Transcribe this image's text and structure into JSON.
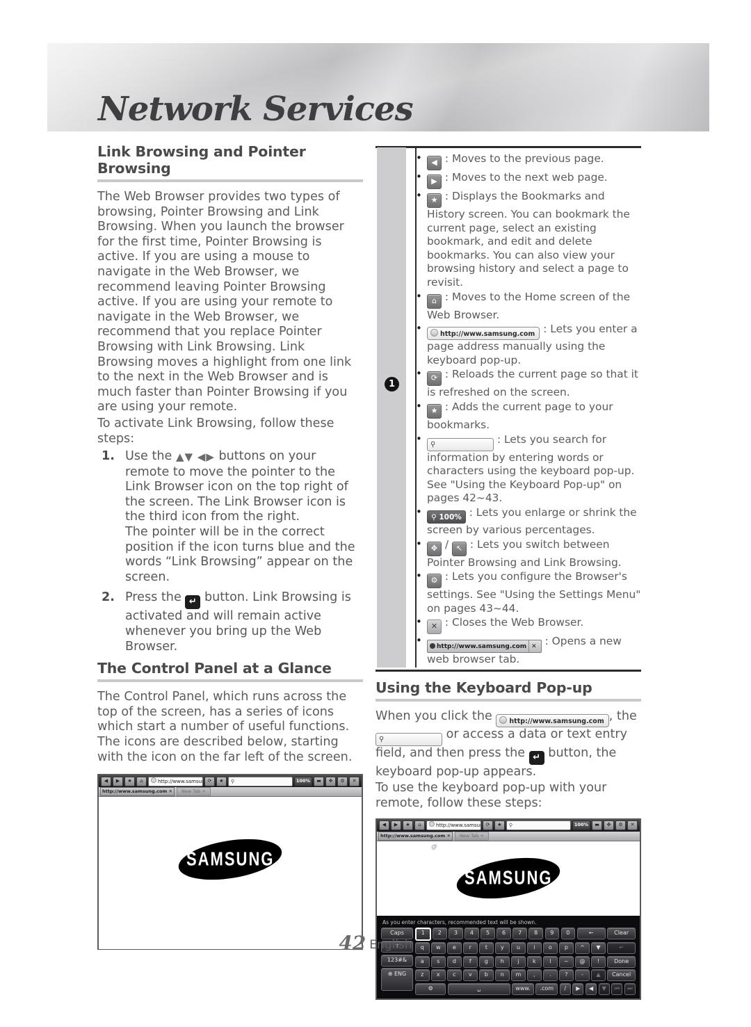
{
  "header": {
    "title": "Network Services"
  },
  "left": {
    "section1_title": "Link Browsing and Pointer Browsing",
    "para1": "The Web Browser provides two types of browsing, Pointer Browsing and Link Browsing. When you launch the browser for the first time, Pointer Browsing is active. If you are using a mouse to navigate in the Web Browser, we recommend leaving Pointer Browsing active. If you are using your remote to navigate in the Web Browser, we recommend that you replace Pointer Browsing with Link Browsing. Link Browsing moves a highlight from one link to the next in the Web Browser and is much faster than Pointer Browsing if you are using your remote.",
    "para2": "To activate Link Browsing, follow these steps:",
    "step1_num": "1.",
    "step1_a": "Use the",
    "step1_arrows": "▲▼ ◀▶",
    "step1_b": "buttons on your remote to move the pointer to the Link Browser icon on the top right of the screen. The Link Browser icon is the third icon from the right.",
    "step1_c": "The pointer will be in the correct position if the icon turns blue and the words “Link Browsing” appear on the screen.",
    "step2_num": "2.",
    "step2_a": "Press the",
    "step2_b": "button. Link Browsing is activated and will remain active whenever you bring up the Web Browser.",
    "section2_title": "The Control Panel at a Glance",
    "para3": "The Control Panel, which runs across the top of the screen, has a series of icons which start a number of useful functions. The icons are described below, starting with the icon on the far left of the screen."
  },
  "right": {
    "marker": "1",
    "bullets": [
      {
        "icon": "back-arrow-icon",
        "glyph": "◀",
        "text": ": Moves to the previous page."
      },
      {
        "icon": "forward-arrow-icon",
        "glyph": "▶",
        "text": ": Moves to the next web page."
      },
      {
        "icon": "bookmarks-history-icon",
        "glyph": "★",
        "text": ": Displays the Bookmarks and History screen. You can bookmark the current page, select an existing bookmark, and edit and delete bookmarks. You can also view your browsing history and select a page to revisit."
      },
      {
        "icon": "home-icon",
        "glyph": "⌂",
        "text": ": Moves to the Home screen of the Web Browser."
      },
      {
        "icon": "url-bar-icon",
        "glyph": "",
        "url": "http://www.samsung.com",
        "text": ": Lets you enter a page address manually using the keyboard pop-up."
      },
      {
        "icon": "reload-icon",
        "glyph": "⟳",
        "text": ": Reloads the current page so that it is refreshed on the screen."
      },
      {
        "icon": "add-bookmark-icon",
        "glyph": "★",
        "text": ": Adds the current page to your bookmarks."
      },
      {
        "icon": "search-field-icon",
        "glyph": "",
        "text": ": Lets you search for information by entering words or characters using the keyboard pop-up. See \"Using the Keyboard Pop-up\" on pages 42~43."
      },
      {
        "icon": "zoom-level-icon",
        "zoom": "100%",
        "text": ": Lets you enlarge or shrink the screen by various percentages."
      },
      {
        "icon": "pointer-link-toggle-icon",
        "glyph1": "✥",
        "glyph2": "↖",
        "sep": "/",
        "text": ": Lets you switch between Pointer Browsing and Link Browsing."
      },
      {
        "icon": "settings-gear-icon",
        "glyph": "⚙",
        "text": ": Lets you configure the Browser's settings. See \"Using the Settings Menu\" on pages 43~44."
      },
      {
        "icon": "close-browser-icon",
        "glyph": "✕",
        "text": ": Closes the Web Browser."
      },
      {
        "icon": "new-tab-icon",
        "url": "http://www.samsung.com",
        "close": "✕",
        "text": ": Opens a new web browser tab."
      }
    ],
    "section3_title": "Using the Keyboard Pop-up",
    "kp_a": "When you click the",
    "kp_url": "http://www.samsung.com",
    "kp_b": ", the",
    "kp_c": "or access a data or text entry field, and then press the",
    "kp_d": "button, the keyboard pop-up appears.",
    "kp_e": "To use the keyboard pop-up with your remote, follow these steps:"
  },
  "screenshot_browser": {
    "url": "http://www.samsung.com",
    "zoom": "100%",
    "tab_label": "http://www.samsung.com",
    "tab_close": "✕",
    "newtab_label": "New Tab +",
    "logo_text": "SAMSUNG"
  },
  "screenshot_keyboard": {
    "url": "http://www.samsung.com",
    "zoom": "100%",
    "tab_label": "http://www.samsung.com",
    "tab_close": "✕",
    "newtab_label": "New Tab +",
    "logo_text": "SAMSUNG",
    "hint": "As you enter characters, recommended text will be shown.",
    "rows": [
      [
        "Caps",
        "1",
        "2",
        "3",
        "4",
        "5",
        "6",
        "7",
        "8",
        "9",
        "0",
        "←",
        "Clear"
      ],
      [
        "⇧",
        "q",
        "w",
        "e",
        "r",
        "t",
        "y",
        "u",
        "i",
        "o",
        "p",
        "^",
        "▼",
        "↵"
      ],
      [
        "123#&",
        "a",
        "s",
        "d",
        "f",
        "g",
        "h",
        "j",
        "k",
        "l",
        "~",
        "@",
        "!",
        "Done"
      ],
      [
        "⊕ ENG",
        "z",
        "x",
        "c",
        "v",
        "b",
        "n",
        "m",
        ",",
        ".",
        "?",
        "-",
        "▲",
        "Cancel"
      ],
      [
        "⚙",
        "␣",
        "www.",
        ".com",
        "/",
        "▶",
        "◀",
        "▼",
        "⏮",
        "⏭"
      ]
    ]
  },
  "footer": {
    "page": "42",
    "language": "English"
  }
}
